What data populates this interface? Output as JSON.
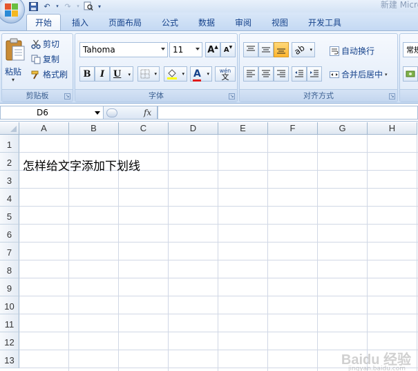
{
  "window": {
    "title": "新建 Micro"
  },
  "tabs": [
    "开始",
    "插入",
    "页面布局",
    "公式",
    "数据",
    "审阅",
    "视图",
    "开发工具"
  ],
  "clipboard": {
    "paste": "粘贴",
    "cut": "剪切",
    "copy": "复制",
    "format_painter": "格式刷",
    "group_label": "剪贴板"
  },
  "font": {
    "name": "Tahoma",
    "size": "11",
    "group_label": "字体",
    "bold": "B",
    "italic": "I",
    "underline": "U",
    "grow": "A",
    "shrink": "A",
    "phonetic": "wén"
  },
  "alignment": {
    "wrap_text": "自动换行",
    "merge_center": "合并后居中",
    "group_label": "对齐方式"
  },
  "number": {
    "format_partial": "常规"
  },
  "formula_bar": {
    "name_box": "D6",
    "fx": "fx",
    "value": ""
  },
  "columns": [
    "A",
    "B",
    "C",
    "D",
    "E",
    "F",
    "G",
    "H"
  ],
  "rows": [
    "1",
    "2",
    "3",
    "4",
    "5",
    "6",
    "7",
    "8",
    "9",
    "10",
    "11",
    "12",
    "13"
  ],
  "cells": {
    "A2": "怎样给文字添加下划线"
  },
  "watermark": {
    "brand": "Baidu 经验",
    "url": "jingyan.baidu.com"
  },
  "colors": {
    "font_color": "#e01b1b",
    "fill_color": "#ffff00",
    "accent": "#15428b"
  }
}
